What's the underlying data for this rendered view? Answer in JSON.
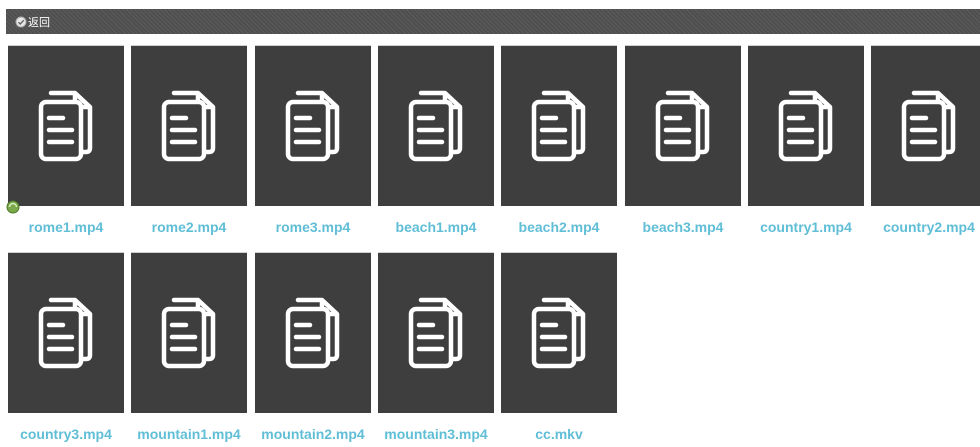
{
  "toolbar": {
    "back_label": "返回",
    "back_icon": "check-circle-icon"
  },
  "files": [
    {
      "name": "rome1.mp4",
      "icon": "document-icon"
    },
    {
      "name": "rome2.mp4",
      "icon": "document-icon"
    },
    {
      "name": "rome3.mp4",
      "icon": "document-icon"
    },
    {
      "name": "beach1.mp4",
      "icon": "document-icon"
    },
    {
      "name": "beach2.mp4",
      "icon": "document-icon"
    },
    {
      "name": "beach3.mp4",
      "icon": "document-icon"
    },
    {
      "name": "country1.mp4",
      "icon": "document-icon"
    },
    {
      "name": "country2.mp4",
      "icon": "document-icon"
    },
    {
      "name": "country3.mp4",
      "icon": "document-icon"
    },
    {
      "name": "mountain1.mp4",
      "icon": "document-icon"
    },
    {
      "name": "mountain2.mp4",
      "icon": "document-icon"
    },
    {
      "name": "mountain3.mp4",
      "icon": "document-icon"
    },
    {
      "name": "cc.mkv",
      "icon": "document-icon"
    }
  ],
  "colors": {
    "tile": "#3e3e3e",
    "caption": "#60bed6",
    "toolbar": "#555555"
  }
}
